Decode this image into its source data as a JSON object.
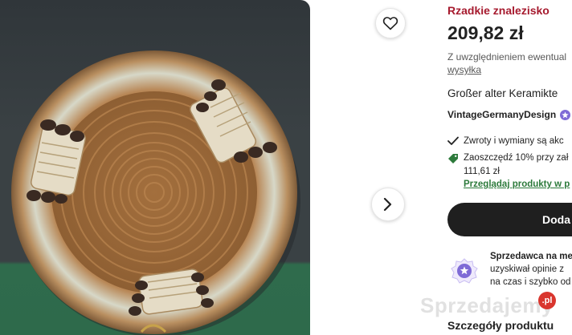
{
  "product": {
    "badge": "Rzadkie znalezisko",
    "price": "209,82 zł",
    "tax_note": "Z uwzględnieniem ewentual",
    "shipping_link": "wysyłka",
    "title": "Großer alter Keramikte",
    "shop_name": "VintageGermanyDesign"
  },
  "features": {
    "returns": "Zwroty i wymiany są akc",
    "savings": "Zaoszczędź 10% przy zał",
    "savings_amount": "111,61 zł",
    "browse_link": "Przeglądaj produkty w p"
  },
  "cart": {
    "add_label": "Doda"
  },
  "seller": {
    "line1": "Sprzedawca na me",
    "line2": "uzyskiwał opinie z",
    "line3": "na czas i szybko od"
  },
  "section": {
    "details_heading": "Szczegóły produktu"
  },
  "watermark": {
    "text": "Sprzedajemy",
    "suffix": ".pl"
  },
  "icons": {
    "favorite": "heart-icon",
    "next": "chevron-right-icon",
    "star_seller": "star-badge-icon",
    "returns": "checkmark-icon",
    "savings": "tag-icon",
    "seller": "star-seller-icon"
  },
  "colors": {
    "badge": "#a61a2e",
    "link_green": "#2c7a3b",
    "button_dark": "#1f1f1f",
    "star_purple": "#7f6bd6"
  }
}
